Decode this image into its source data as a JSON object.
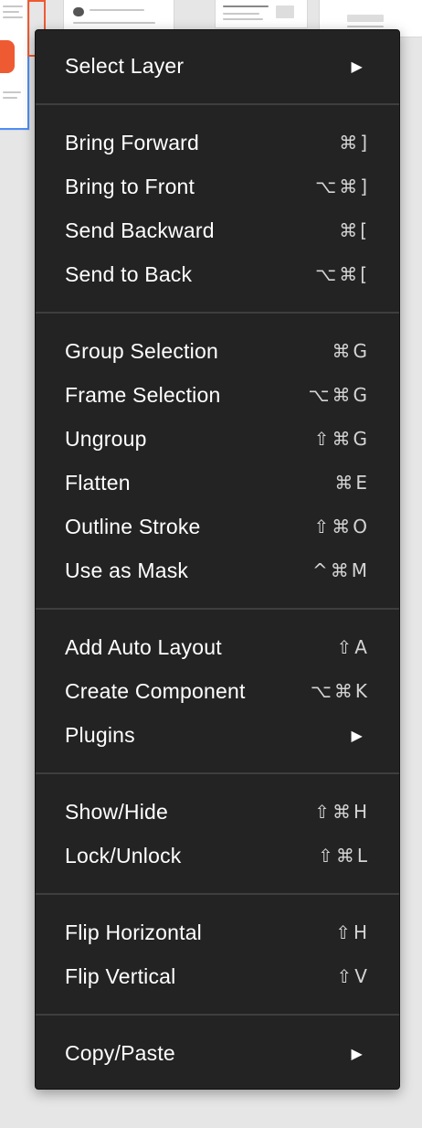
{
  "menu": {
    "groups": [
      [
        {
          "label": "Select Layer",
          "shortcut": "",
          "submenu": true
        }
      ],
      [
        {
          "label": "Bring Forward",
          "shortcut": "⌘]"
        },
        {
          "label": "Bring to Front",
          "shortcut": "⌥⌘]"
        },
        {
          "label": "Send Backward",
          "shortcut": "⌘["
        },
        {
          "label": "Send to Back",
          "shortcut": "⌥⌘["
        }
      ],
      [
        {
          "label": "Group Selection",
          "shortcut": "⌘G"
        },
        {
          "label": "Frame Selection",
          "shortcut": "⌥⌘G"
        },
        {
          "label": "Ungroup",
          "shortcut": "⇧⌘G"
        },
        {
          "label": "Flatten",
          "shortcut": "⌘E"
        },
        {
          "label": "Outline Stroke",
          "shortcut": "⇧⌘O"
        },
        {
          "label": "Use as Mask",
          "shortcut": "^⌘M"
        }
      ],
      [
        {
          "label": "Add Auto Layout",
          "shortcut": "⇧A"
        },
        {
          "label": "Create Component",
          "shortcut": "⌥⌘K"
        },
        {
          "label": "Plugins",
          "shortcut": "",
          "submenu": true
        }
      ],
      [
        {
          "label": "Show/Hide",
          "shortcut": "⇧⌘H"
        },
        {
          "label": "Lock/Unlock",
          "shortcut": "⇧⌘L"
        }
      ],
      [
        {
          "label": "Flip Horizontal",
          "shortcut": "⇧H"
        },
        {
          "label": "Flip Vertical",
          "shortcut": "⇧V"
        }
      ],
      [
        {
          "label": "Copy/Paste",
          "shortcut": "",
          "submenu": true
        }
      ]
    ],
    "submenu_icon": "triangle-right-icon",
    "colors": {
      "background": "#232323",
      "text": "#ffffff",
      "shortcut": "#d4d4d4",
      "separator": "#3e3e3e"
    }
  }
}
